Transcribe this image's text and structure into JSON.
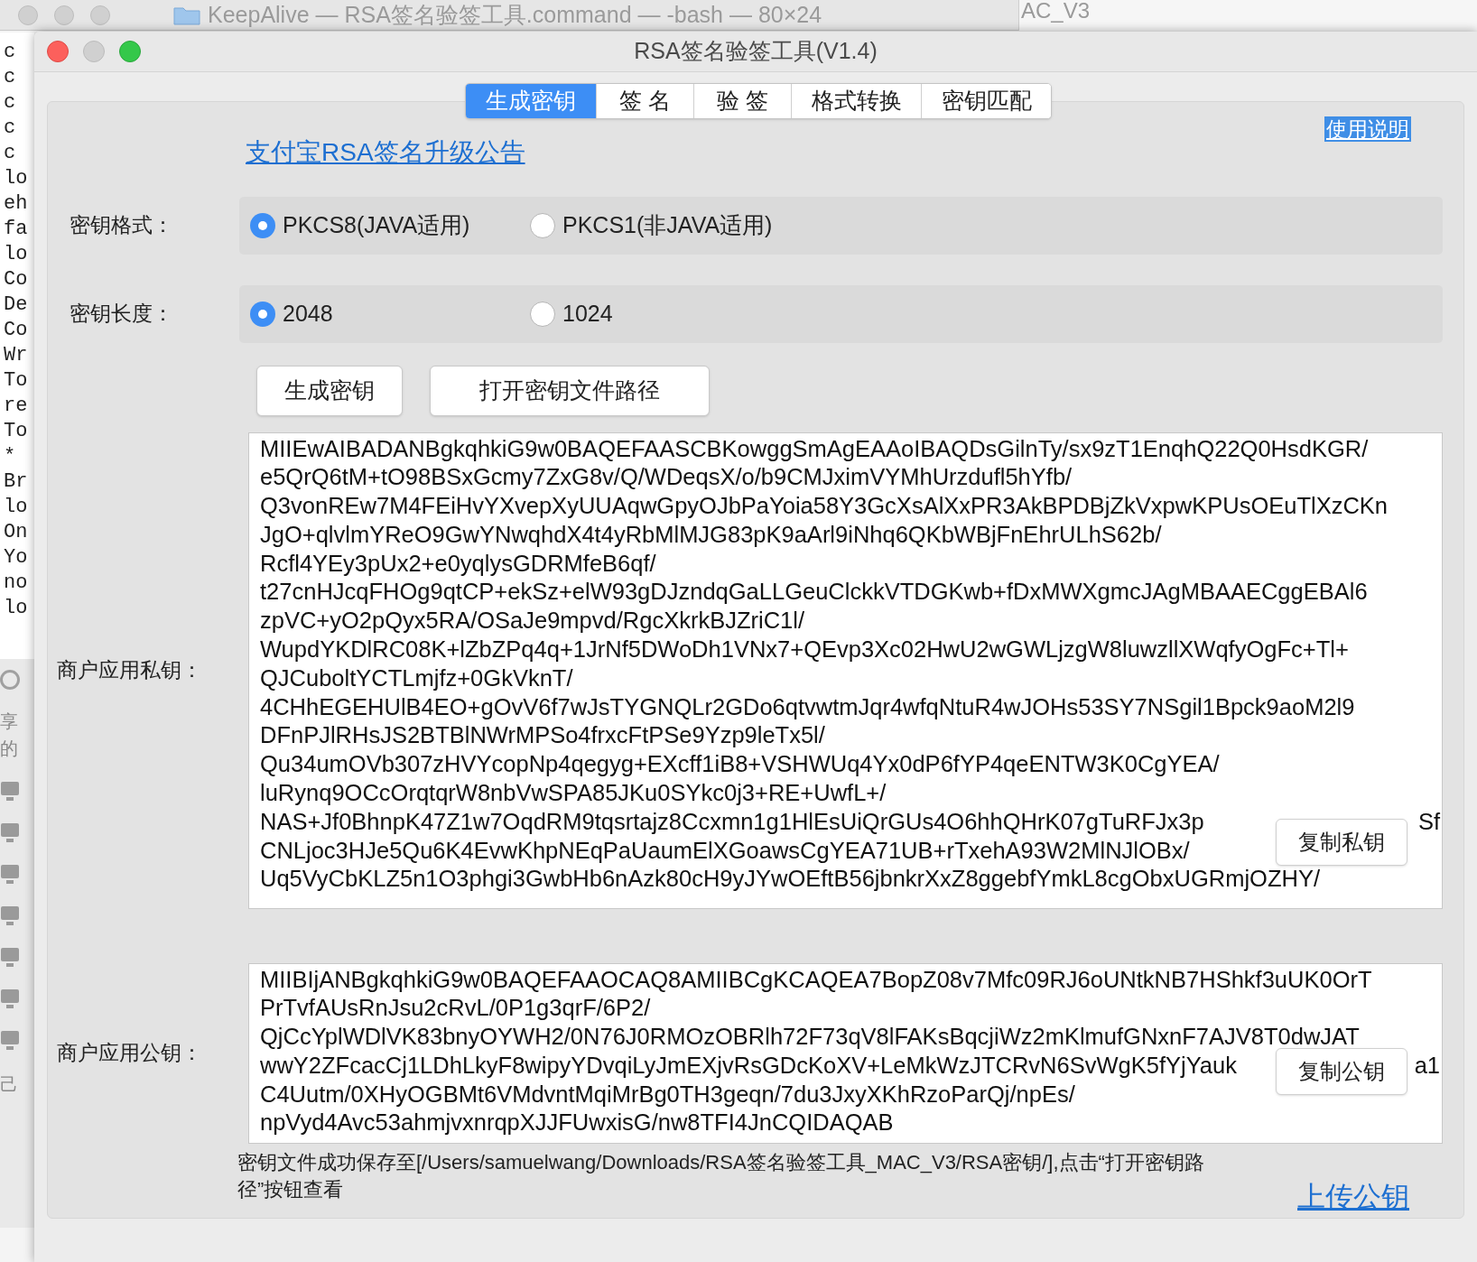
{
  "background_terminal": {
    "title": "KeepAlive — RSA签名验签工具.command — -bash — 80×24",
    "lines": [
      "c",
      "c",
      "c",
      "c",
      "c",
      "lo",
      "eh",
      "fa",
      "lo",
      "Co",
      "De",
      "Co",
      "Wr",
      "To",
      "re",
      "To",
      "*",
      "Br",
      "lo",
      "On",
      "Yo",
      "no",
      "lo"
    ]
  },
  "background_window": {
    "title": "AC_V3"
  },
  "finder_sidebar": {
    "heading": "享的",
    "footer": "己"
  },
  "window": {
    "title": "RSA签名验签工具(V1.4)"
  },
  "tabs": [
    {
      "label": "生成密钥",
      "selected": true
    },
    {
      "label": "签 名",
      "selected": false
    },
    {
      "label": "验 签",
      "selected": false
    },
    {
      "label": "格式转换",
      "selected": false
    },
    {
      "label": "密钥匹配",
      "selected": false
    }
  ],
  "help_link": "使用说明",
  "announcement_link": "支付宝RSA签名升级公告",
  "key_format": {
    "label": "密钥格式：",
    "options": [
      {
        "label": "PKCS8(JAVA适用)",
        "selected": true
      },
      {
        "label": "PKCS1(非JAVA适用)",
        "selected": false
      }
    ]
  },
  "key_length": {
    "label": "密钥长度：",
    "options": [
      {
        "label": "2048",
        "selected": true
      },
      {
        "label": "1024",
        "selected": false
      }
    ]
  },
  "buttons": [
    "生成密钥",
    "打开密钥文件路径"
  ],
  "private_key": {
    "label": "商户应用私钥：",
    "copy_button": "复制私钥",
    "lines": [
      {
        "text": "MIIEwAIBADANBgkqhkiG9w0BAQEFAASCBKowggSmAgEAAoIBAQDsGilnTy/sx9zT1EnqhQ22Q0HsdKGR/"
      },
      {
        "text": "e5QrQ6tM+tO98BSxGcmy7ZxG8v/Q/WDeqsX/o/b9CMJximVYMhUrzdufl5hYfb/"
      },
      {
        "text": "Q3vonREw7M4FEiHvYXvepXyUUAqwGpyOJbPaYoia58Y3GcXsAlXxPR3AkBPDBjZkVxpwKPUsOEuTlXzCKn"
      },
      {
        "text": "JgO+qlvlmYReO9GwYNwqhdX4t4yRbMlMJG83pK9aArl9iNhq6QKbWBjFnEhrULhS62b/"
      },
      {
        "text": "Rcfl4YEy3pUx2+e0yqlysGDRMfeB6qf/"
      },
      {
        "text": "t27cnHJcqFHOg9qtCP+ekSz+elW93gDJzndqGaLLGeuClckkVTDGKwb+fDxMWXgmcJAgMBAAECggEBAl6"
      },
      {
        "text": "zpVC+yO2pQyx5RA/OSaJe9mpvd/RgcXkrkBJZriC1l/"
      },
      {
        "text": "WupdYKDlRC08K+lZbZPq4q+1JrNf5DWoDh1VNx7+QEvp3Xc02HwU2wGWLjzgW8luwzllXWqfyOgFc+Tl+"
      },
      {
        "text": "QJCuboltYCTLmjfz+0GkVknT/"
      },
      {
        "text": "4CHhEGEHUlB4EO+gOvV6f7wJsTYGNQLr2GDo6qtvwtmJqr4wfqNtuR4wJOHs53SY7NSgil1Bpck9aoM2l9"
      },
      {
        "text": "DFnPJlRHsJS2BTBlNWrMPSo4frxcFtPSe9Yzp9leTx5l/"
      },
      {
        "text": "Qu34umOVb307zHVYcopNp4qegyg+EXcff1iB8+VSHWUq4Yx0dP6fYP4qeENTW3K0CgYEA/"
      },
      {
        "text": "luRynq9OCcOrqtqrW8nbVwSPA85JKu0SYkc0j3+RE+UwfL+/"
      },
      {
        "text": "NAS+Jf0BhnpK47Z1w7OqdRM9tqsrtajz8Ccxmn1g1HlEsUiQrGUs4O6hhQHrK07gTuRFJx3p",
        "tail": "Sf"
      },
      {
        "text": "CNLjoc3HJe5Qu6K4EvwKhpNEqPaUaumElXGoawsCgYEA71UB+rTxehA93W2MlNJlOBx/"
      },
      {
        "text": "Uq5VyCbKLZ5n1O3phgi3GwbHb6nAzk80cH9yJYwOEftB56jbnkrXxZ8ggebfYmkL8cgObxUGRmjOZHY/"
      }
    ]
  },
  "public_key": {
    "label": "商户应用公钥：",
    "copy_button": "复制公钥",
    "lines": [
      {
        "text": "MIIBIjANBgkqhkiG9w0BAQEFAAOCAQ8AMIIBCgKCAQEA7BopZ08v7Mfc09RJ6oUNtkNB7HShkf3uUK0OrT"
      },
      {
        "text": "PrTvfAUsRnJsu2cRvL/0P1g3qrF/6P2/"
      },
      {
        "text": "QjCcYplWDlVK83bnyOYWH2/0N76J0RMOzOBRlh72F73qV8lFAKsBqcjiWz2mKlmufGNxnF7AJV8T0dwJAT"
      },
      {
        "text": "wwY2ZFcacCj1LDhLkyF8wipyYDvqiLyJmEXjvRsGDcKoXV+LeMkWzJTCRvN6SvWgK5fYjYauk",
        "tail": "a1"
      },
      {
        "text": "C4Uutm/0XHyOGBMt6VMdvntMqiMrBg0TH3geqn/7du3JxyXKhRzoParQj/npEs/"
      },
      {
        "text": "npVyd4Avc53ahmjvxnrqpXJJFUwxisG/nw8TFI4JnCQIDAQAB"
      }
    ]
  },
  "status_message": "密钥文件成功保存至[/Users/samuelwang/Downloads/RSA签名验签工具_MAC_V3/RSA密钥/],点击“打开密钥路径”按钮查看",
  "upload_link": "上传公钥"
}
